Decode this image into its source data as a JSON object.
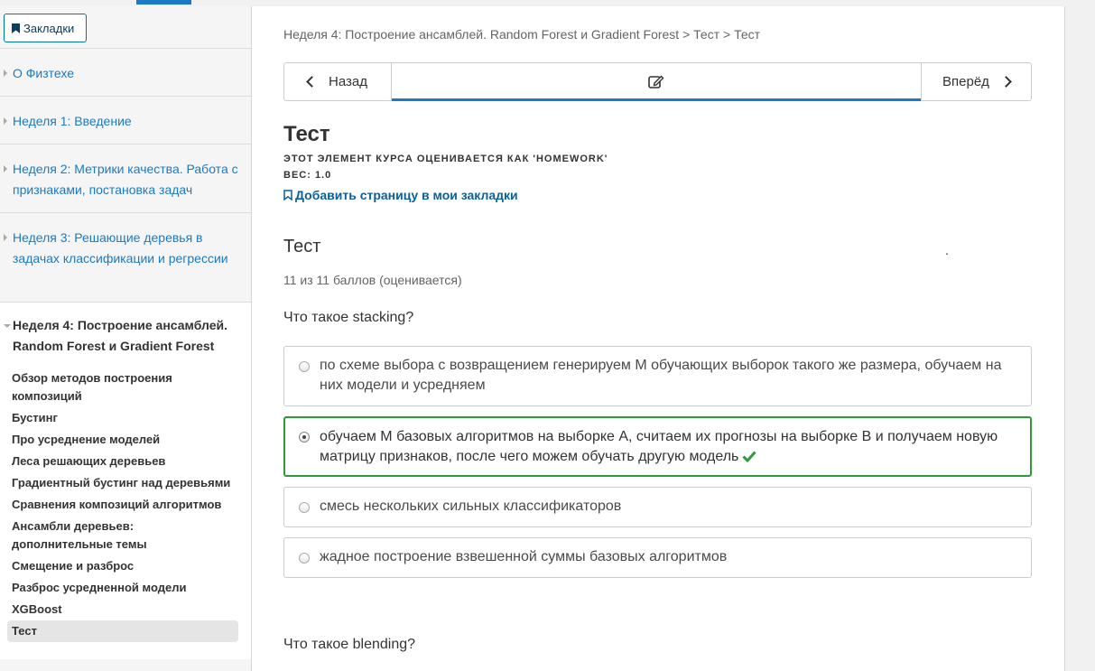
{
  "sidebar": {
    "bookmarks_label": "Закладки",
    "chapters": [
      {
        "title": "О Физтехе"
      },
      {
        "title": "Неделя 1: Введение"
      },
      {
        "title": "Неделя 2: Метрики качества. Работа с признаками, постановка задач"
      },
      {
        "title": "Неделя 3: Решающие деревья в задачах классификации и регрессии"
      },
      {
        "title": "Неделя 4: Построение ансамблей. Random Forest и Gradient Forest"
      }
    ],
    "sections": [
      "Обзор методов построения композиций",
      "Бустинг",
      "Про усреднение моделей",
      "Леса решающих деревьев",
      "Градиентный бустинг над деревьями",
      "Сравнения композиций алгоритмов",
      "Ансамбли деревьев: дополнительные темы",
      "Смещение и разброс",
      "Разброс усредненной модели",
      "XGBoost",
      "Тест"
    ]
  },
  "main": {
    "breadcrumb": "Неделя 4: Построение ансамблей. Random Forest и Gradient Forest > Тест > Тест",
    "nav": {
      "prev": "Назад",
      "next": "Вперёд"
    },
    "unit_title": "Тест",
    "grading_line1": "ЭТОТ ЭЛЕМЕНТ КУРСА ОЦЕНИВАЕТСЯ КАК 'HOMEWORK'",
    "grading_line2": "ВЕС: 1.0",
    "add_bookmark": "Добавить страницу в мои закладки",
    "problem_title": "Тест",
    "dot": ".",
    "score": "11 из 11 баллов (оценивается)",
    "question1": "Что такое stacking?",
    "options": [
      "по схеме выбора с возвращением генерируем M обучающих выборок такого же размера, обучаем на них модели и усредняем",
      "обучаем M базовых алгоритмов на выборке A, считаем их прогнозы на выборке B и получаем новую матрицу признаков, после чего можем обучать другую модель",
      "смесь нескольких сильных классификаторов",
      "жадное построение взвешенной суммы базовых алгоритмов"
    ],
    "selected_option": 1,
    "question2": "Что такое blending?"
  },
  "colors": {
    "accent": "#1a7ac6",
    "correct": "#2e9b3a"
  }
}
